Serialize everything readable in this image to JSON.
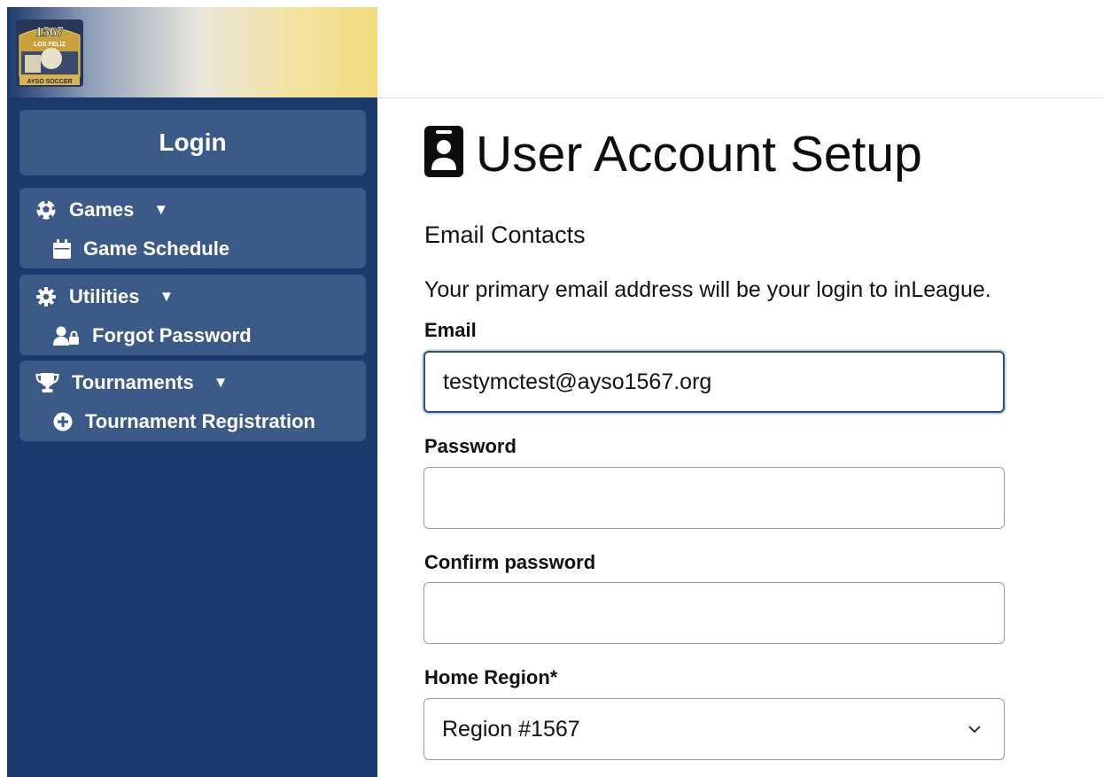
{
  "header": {
    "logo": {
      "top_text": "1567",
      "ribbon_text": "LOS FELIZ",
      "bottom_text": "AYSO SOCCER",
      "icon": "ayso-region-logo"
    }
  },
  "sidebar": {
    "login_label": "Login",
    "groups": [
      {
        "label": "Games",
        "icon": "soccer-ball-icon",
        "caret": "▼",
        "items": [
          {
            "label": "Game Schedule",
            "icon": "calendar-icon"
          }
        ]
      },
      {
        "label": "Utilities",
        "icon": "gear-icon",
        "caret": "▼",
        "items": [
          {
            "label": "Forgot Password",
            "icon": "user-lock-icon"
          }
        ]
      },
      {
        "label": "Tournaments",
        "icon": "trophy-icon",
        "caret": "▼",
        "items": [
          {
            "label": "Tournament Registration",
            "icon": "plus-circle-icon"
          }
        ]
      }
    ]
  },
  "main": {
    "title": "User Account Setup",
    "title_icon": "id-badge-icon",
    "section_title": "Email Contacts",
    "intro": "Your primary email address will be your login to inLeague.",
    "email": {
      "label": "Email",
      "value": "testymctest@ayso1567.org"
    },
    "password": {
      "label": "Password",
      "value": ""
    },
    "confirm_password": {
      "label": "Confirm password",
      "value": ""
    },
    "home_region": {
      "label": "Home Region*",
      "selected": "Region #1567"
    }
  },
  "colors": {
    "sidebar_bg": "#1c3a6e",
    "sidebar_box": "#3c5a87",
    "focus_border": "#2b4d7e"
  }
}
